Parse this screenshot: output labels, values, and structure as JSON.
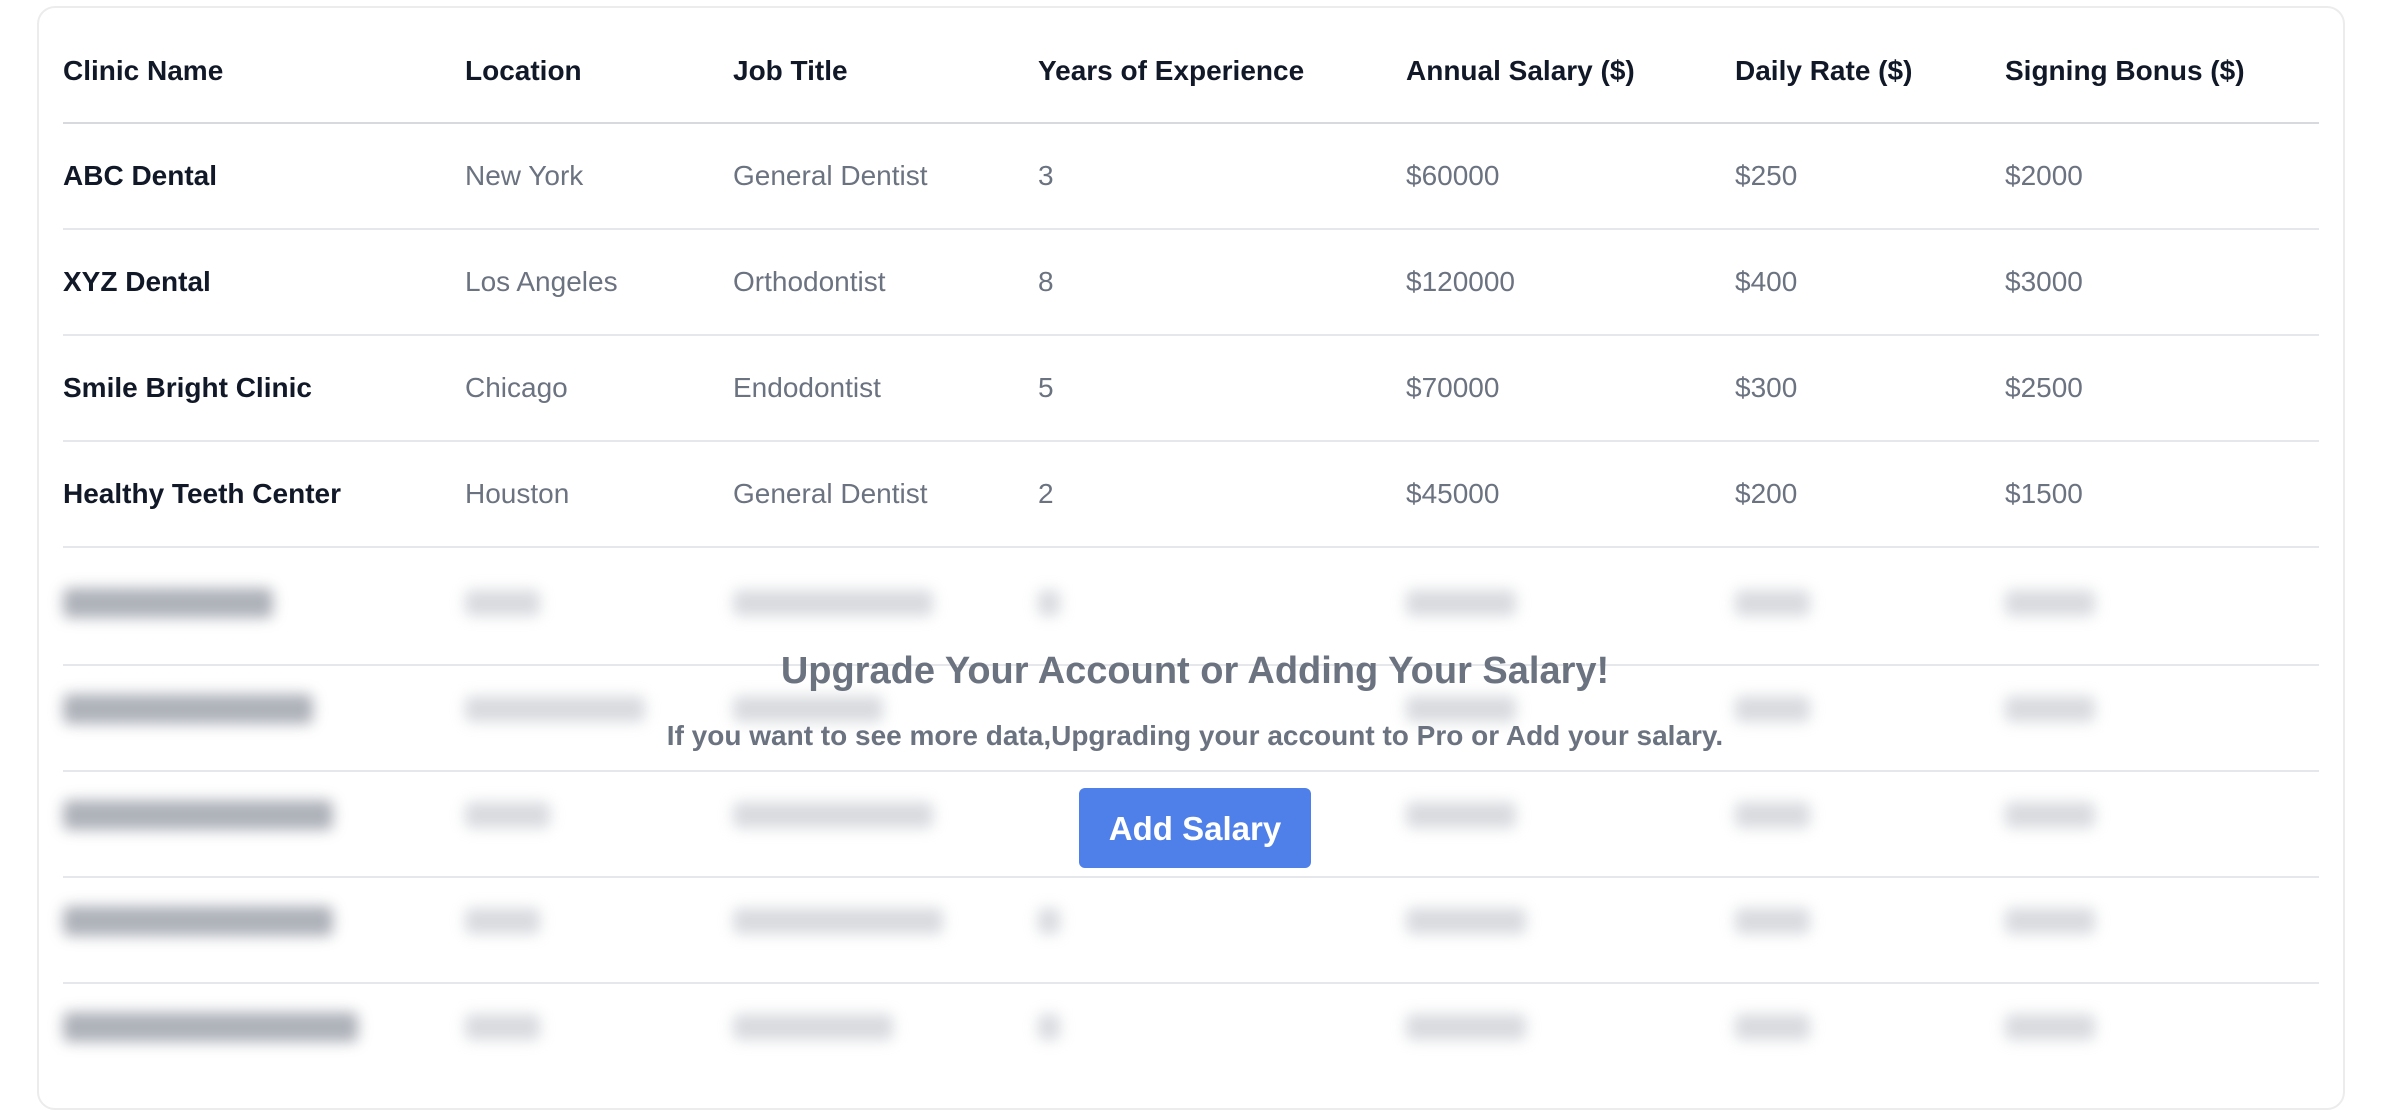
{
  "table": {
    "columns": [
      "Clinic Name",
      "Location",
      "Job Title",
      "Years of Experience",
      "Annual Salary ($)",
      "Daily Rate ($)",
      "Signing Bonus ($)"
    ],
    "rows": [
      [
        "ABC Dental",
        "New York",
        "General Dentist",
        "3",
        "$60000",
        "$250",
        "$2000"
      ],
      [
        "XYZ Dental",
        "Los Angeles",
        "Orthodontist",
        "8",
        "$120000",
        "$400",
        "$3000"
      ],
      [
        "Smile Bright Clinic",
        "Chicago",
        "Endodontist",
        "5",
        "$70000",
        "$300",
        "$2500"
      ],
      [
        "Healthy Teeth Center",
        "Houston",
        "General Dentist",
        "2",
        "$45000",
        "$200",
        "$1500"
      ]
    ]
  },
  "upgrade": {
    "title": "Upgrade Your Account or Adding Your Salary!",
    "subtitle": "If you want to see more data,Upgrading your account to Pro or Add your salary.",
    "button_label": "Add Salary"
  },
  "colors": {
    "accent": "#4f7fe8",
    "header_text": "#111827",
    "cell_text": "#6b7280"
  }
}
